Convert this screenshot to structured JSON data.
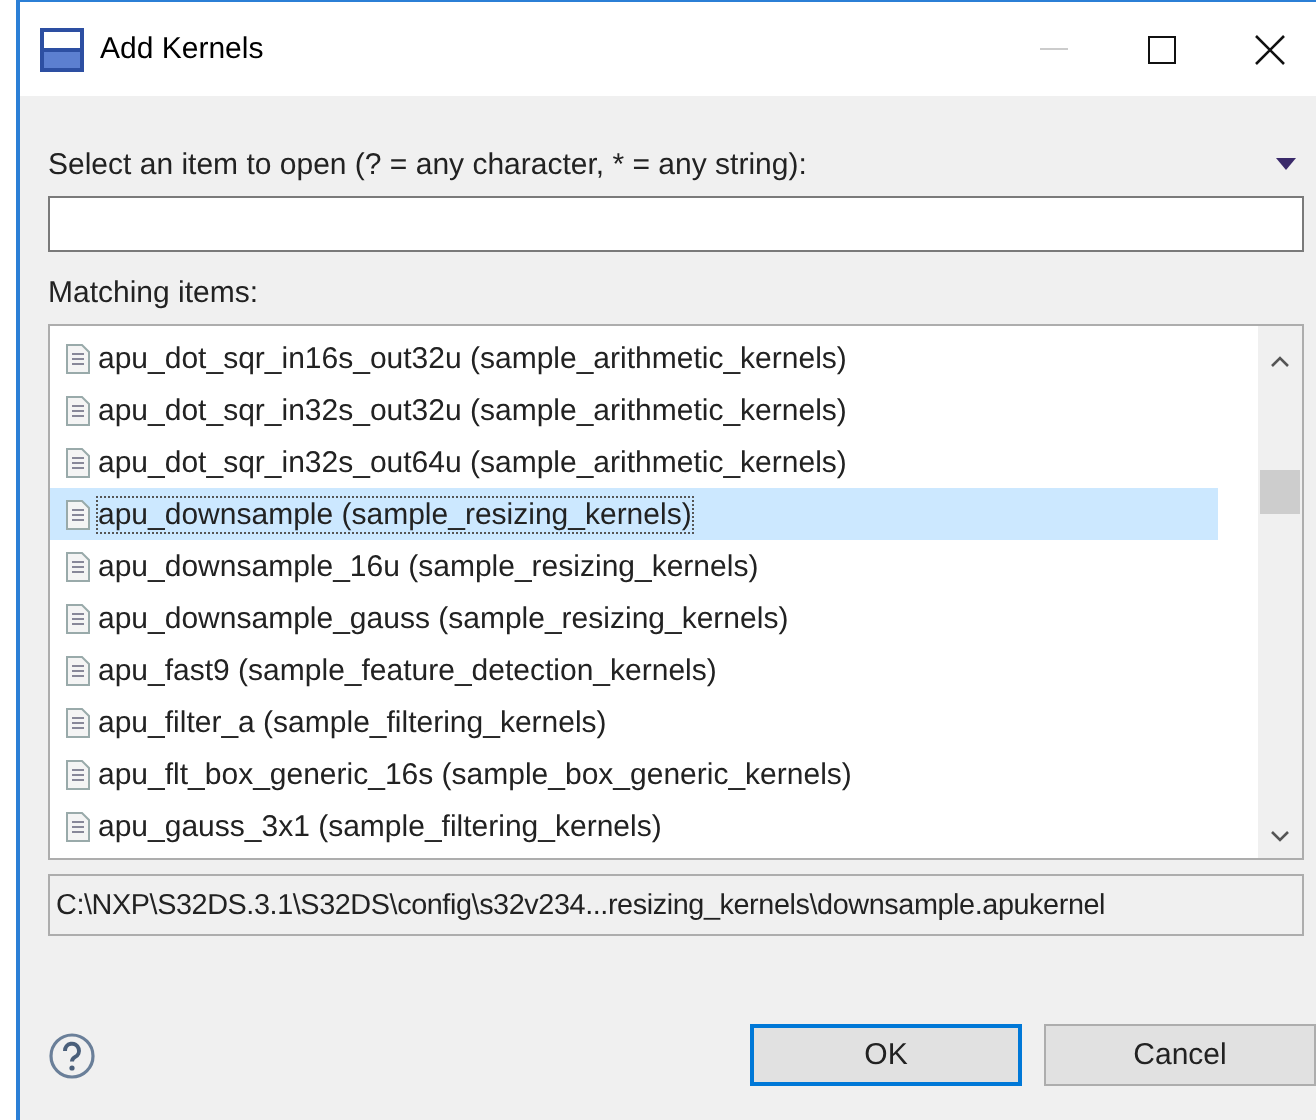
{
  "window": {
    "title": "Add Kernels"
  },
  "filter": {
    "label": "Select an item to open (? = any character, * = any string):"
  },
  "matching": {
    "label": "Matching items:",
    "items": [
      {
        "label": "apu_dot_sqr_in16s_out32u (sample_arithmetic_kernels)",
        "selected": false
      },
      {
        "label": "apu_dot_sqr_in32s_out32u (sample_arithmetic_kernels)",
        "selected": false
      },
      {
        "label": "apu_dot_sqr_in32s_out64u (sample_arithmetic_kernels)",
        "selected": false
      },
      {
        "label": "apu_downsample (sample_resizing_kernels)",
        "selected": true
      },
      {
        "label": "apu_downsample_16u (sample_resizing_kernels)",
        "selected": false
      },
      {
        "label": "apu_downsample_gauss (sample_resizing_kernels)",
        "selected": false
      },
      {
        "label": "apu_fast9 (sample_feature_detection_kernels)",
        "selected": false
      },
      {
        "label": "apu_filter_a (sample_filtering_kernels)",
        "selected": false
      },
      {
        "label": "apu_flt_box_generic_16s (sample_box_generic_kernels)",
        "selected": false
      },
      {
        "label": "apu_gauss_3x1 (sample_filtering_kernels)",
        "selected": false
      }
    ]
  },
  "path": "C:\\NXP\\S32DS.3.1\\S32DS\\config\\s32v234...resizing_kernels\\downsample.apukernel",
  "buttons": [
    {
      "label": "OK",
      "default": true
    },
    {
      "label": "Cancel",
      "default": false
    }
  ]
}
